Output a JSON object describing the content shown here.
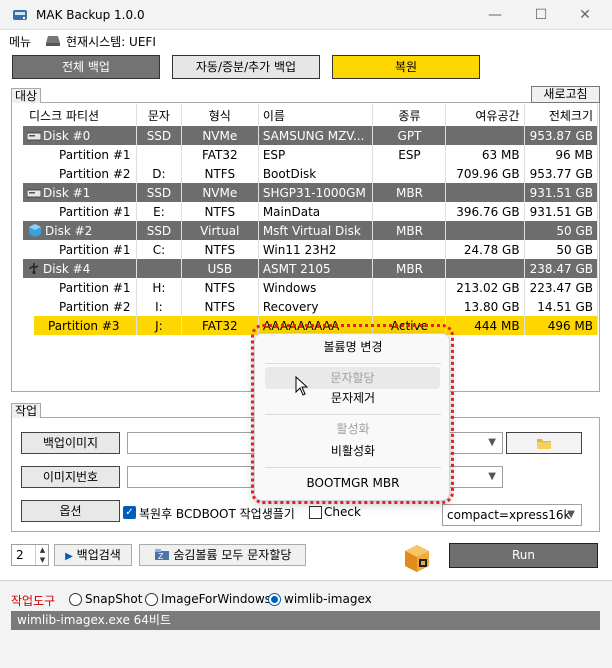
{
  "window": {
    "title": "MAK Backup 1.0.0",
    "minimize": "—",
    "maximize": "☐",
    "close": "✕"
  },
  "menu": {
    "label": "메뉴",
    "system_label": "현재시스템: UEFI"
  },
  "modes": {
    "full": "전체 백업",
    "auto": "자동/증분/추가 백업",
    "restore": "복원"
  },
  "target": {
    "label": "대상",
    "refresh": "새로고침",
    "headers": [
      "디스크 파티션",
      "문자",
      "형식",
      "이름",
      "종류",
      "여유공간",
      "전체크기"
    ],
    "rows": [
      {
        "kind": "disk",
        "icon": "hdd",
        "c": [
          "Disk #0",
          "SSD",
          "NVMe",
          "SAMSUNG MZV...",
          "GPT",
          "",
          "953.87 GB"
        ]
      },
      {
        "kind": "part",
        "c": [
          "Partition #1",
          "",
          "FAT32",
          "ESP",
          "ESP",
          "63 MB",
          "96 MB"
        ]
      },
      {
        "kind": "part",
        "c": [
          "Partition #2",
          "D:",
          "NTFS",
          "BootDisk",
          "",
          "709.96 GB",
          "953.77 GB"
        ]
      },
      {
        "kind": "disk",
        "icon": "hdd",
        "c": [
          "Disk #1",
          "SSD",
          "NVMe",
          "SHGP31-1000GM",
          "MBR",
          "",
          "931.51 GB"
        ]
      },
      {
        "kind": "part",
        "c": [
          "Partition #1",
          "E:",
          "NTFS",
          "MainData",
          "",
          "396.76 GB",
          "931.51 GB"
        ]
      },
      {
        "kind": "disk",
        "icon": "vhd",
        "c": [
          "Disk #2",
          "SSD",
          "Virtual",
          "Msft Virtual Disk",
          "MBR",
          "",
          "50 GB"
        ]
      },
      {
        "kind": "part",
        "c": [
          "Partition #1",
          "C:",
          "NTFS",
          "Win11 23H2",
          "",
          "24.78 GB",
          "50 GB"
        ]
      },
      {
        "kind": "disk",
        "icon": "usb",
        "c": [
          "Disk #4",
          "",
          "USB",
          "ASMT 2105",
          "MBR",
          "",
          "238.47 GB"
        ]
      },
      {
        "kind": "part",
        "c": [
          "Partition #1",
          "H:",
          "NTFS",
          "Windows",
          "",
          "213.02 GB",
          "223.47 GB"
        ]
      },
      {
        "kind": "part",
        "c": [
          "Partition #2",
          "I:",
          "NTFS",
          "Recovery",
          "",
          "13.80 GB",
          "14.51 GB"
        ]
      },
      {
        "kind": "sel",
        "c": [
          "Partition #3",
          "J:",
          "FAT32",
          "AAAAAAAAA",
          "Active",
          "444 MB",
          "496 MB"
        ]
      }
    ]
  },
  "task": {
    "label": "작업",
    "backup_image_btn": "백업이미지",
    "image_number_btn": "이미지번호",
    "options_btn": "옵션",
    "bcdboot_label": "복원후 BCDBOOT 작업생플기",
    "check_label": "Check",
    "compression": "compact=xpress16k"
  },
  "bottom": {
    "spinner_value": "2",
    "search_label": "백업검색",
    "hidden_label": "숨김볼륨 모두 문자할당",
    "run_label": "Run"
  },
  "tools": {
    "label": "작업도구",
    "options": [
      "SnapShot",
      "ImageForWindows",
      "wimlib-imagex"
    ],
    "selected": 2,
    "status": "wimlib-imagex.exe 64비트"
  },
  "context_menu": {
    "items": [
      {
        "label": "볼륨명 변경",
        "enabled": true
      },
      {
        "label": "문자할당",
        "enabled": false
      },
      {
        "label": "문자제거",
        "enabled": true
      },
      {
        "label": "활성화",
        "enabled": false
      },
      {
        "label": "비활성화",
        "enabled": true
      },
      {
        "label": "BOOTMGR MBR",
        "enabled": true
      }
    ]
  },
  "colors": {
    "accent_yellow": "#ffd700",
    "disk_row_gray": "#6d6d6d",
    "highlight_red": "#e0202a",
    "run_button": "#6f6f6f"
  }
}
